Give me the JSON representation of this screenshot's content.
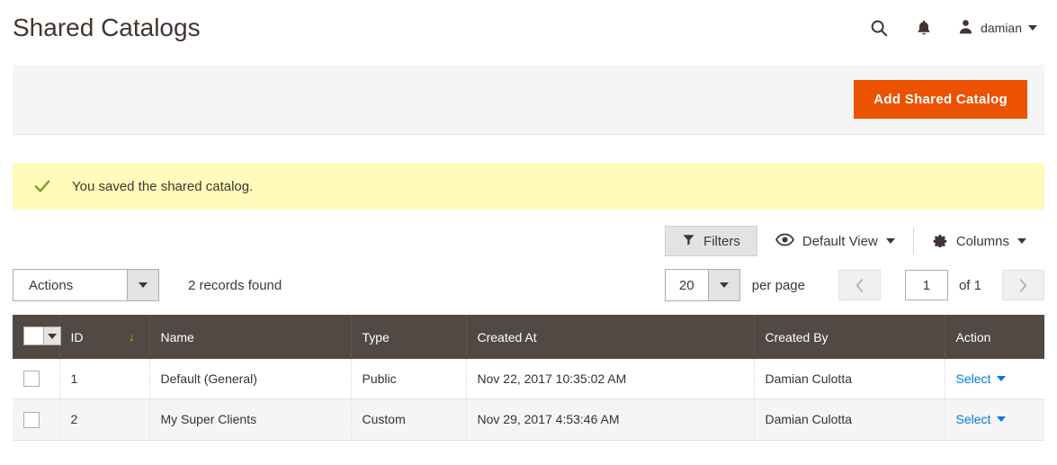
{
  "header": {
    "title": "Shared Catalogs",
    "search_icon": "search-icon",
    "notifications_icon": "bell-icon",
    "user_icon": "user-avatar-icon",
    "user_name": "damian"
  },
  "page_actions": {
    "add_label": "Add Shared Catalog",
    "accent_color": "#eb5202"
  },
  "message": {
    "icon": "check-icon",
    "text": "You saved the shared catalog.",
    "background": "#fffbbb",
    "icon_color": "#79a22e"
  },
  "toolbar": {
    "filters_label": "Filters",
    "filters_icon": "funnel-icon",
    "view_label": "Default View",
    "view_icon": "eye-icon",
    "columns_label": "Columns",
    "columns_icon": "gear-icon"
  },
  "actions": {
    "label": "Actions",
    "records_found": "2 records found"
  },
  "paging": {
    "per_page_value": "20",
    "per_page_label": "per page",
    "prev_icon": "chevron-left-icon",
    "next_icon": "chevron-right-icon",
    "current_page": "1",
    "of_label": "of 1"
  },
  "grid": {
    "select_all_icon": "checkbox-dropdown-icon",
    "sort_indicator": "↓",
    "sort_color": "#ff9700",
    "header_background": "#514943",
    "columns": [
      {
        "key": "id",
        "label": "ID"
      },
      {
        "key": "name",
        "label": "Name"
      },
      {
        "key": "type",
        "label": "Type"
      },
      {
        "key": "created_at",
        "label": "Created At"
      },
      {
        "key": "created_by",
        "label": "Created By"
      },
      {
        "key": "action",
        "label": "Action"
      }
    ],
    "rows": [
      {
        "id": "1",
        "name": "Default (General)",
        "type": "Public",
        "created_at": "Nov 22, 2017 10:35:02 AM",
        "created_by": "Damian Culotta",
        "action_label": "Select"
      },
      {
        "id": "2",
        "name": "My Super Clients",
        "type": "Custom",
        "created_at": "Nov 29, 2017 4:53:46 AM",
        "created_by": "Damian Culotta",
        "action_label": "Select"
      }
    ]
  }
}
